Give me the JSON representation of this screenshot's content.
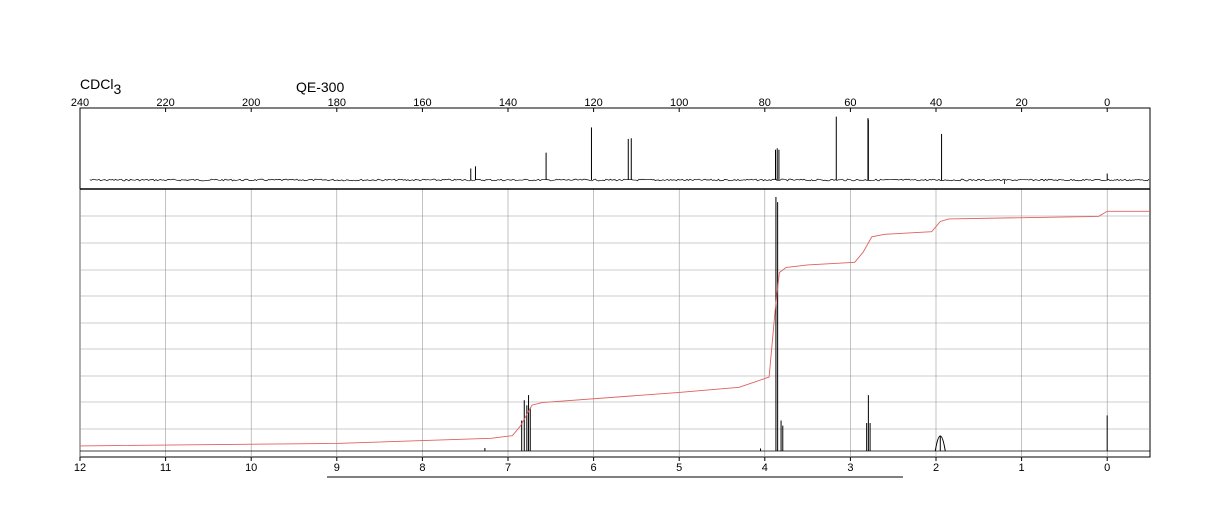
{
  "header": {
    "solvent_main": "CDCl",
    "solvent_sub": "3",
    "instrument": "QE-300"
  },
  "chart_data": [
    {
      "type": "line",
      "name": "13C NMR spectrum",
      "x_axis": {
        "range": [
          240,
          -10
        ],
        "ticks": [
          240,
          220,
          200,
          180,
          160,
          140,
          120,
          100,
          80,
          60,
          40,
          20,
          0
        ],
        "tick_labels": [
          "240",
          "220",
          "200",
          "180",
          "160",
          "140",
          "120",
          "100",
          "80",
          "60",
          "40",
          "20",
          "0"
        ]
      },
      "y_axis": {
        "range": [
          0,
          1
        ]
      },
      "peaks": [
        {
          "x": 148.7,
          "y": 0.16
        },
        {
          "x": 147.6,
          "y": 0.19
        },
        {
          "x": 131.1,
          "y": 0.38
        },
        {
          "x": 120.5,
          "y": 0.73
        },
        {
          "x": 111.9,
          "y": 0.57
        },
        {
          "x": 111.2,
          "y": 0.58
        },
        {
          "x": 77.5,
          "y": 0.42
        },
        {
          "x": 77.1,
          "y": 0.44
        },
        {
          "x": 76.7,
          "y": 0.42
        },
        {
          "x": 63.3,
          "y": 0.88
        },
        {
          "x": 55.9,
          "y": 0.86
        },
        {
          "x": 55.8,
          "y": 0.84
        },
        {
          "x": 38.7,
          "y": 0.64
        },
        {
          "x": 0.0,
          "y": 0.09
        }
      ],
      "grid": false
    },
    {
      "type": "line",
      "name": "1H NMR spectrum",
      "x_axis": {
        "range": [
          12,
          -0.5
        ],
        "ticks": [
          12,
          11,
          10,
          9,
          8,
          7,
          6,
          5,
          4,
          3,
          2,
          1,
          0
        ],
        "tick_labels": [
          "12",
          "11",
          "10",
          "9",
          "8",
          "7",
          "6",
          "5",
          "4",
          "3",
          "2",
          "1",
          "0"
        ]
      },
      "y_axis": {
        "range": [
          0,
          1
        ]
      },
      "peaks": [
        {
          "x": 7.27,
          "y": 0.012
        },
        {
          "x": 6.84,
          "y": 0.12
        },
        {
          "x": 6.81,
          "y": 0.2
        },
        {
          "x": 6.78,
          "y": 0.18
        },
        {
          "x": 6.76,
          "y": 0.22
        },
        {
          "x": 6.74,
          "y": 0.17
        },
        {
          "x": 4.05,
          "y": 0.01
        },
        {
          "x": 3.87,
          "y": 1.0
        },
        {
          "x": 3.85,
          "y": 0.98
        },
        {
          "x": 3.81,
          "y": 0.12
        },
        {
          "x": 3.79,
          "y": 0.1
        },
        {
          "x": 2.81,
          "y": 0.11
        },
        {
          "x": 2.79,
          "y": 0.22
        },
        {
          "x": 2.77,
          "y": 0.11
        },
        {
          "x": 1.95,
          "y": 0.06
        },
        {
          "x": 0.0,
          "y": 0.14
        }
      ],
      "integral_curve": [
        {
          "x": 12.0,
          "y": 0.02
        },
        {
          "x": 9.0,
          "y": 0.03
        },
        {
          "x": 7.2,
          "y": 0.05
        },
        {
          "x": 6.95,
          "y": 0.06
        },
        {
          "x": 6.85,
          "y": 0.1
        },
        {
          "x": 6.72,
          "y": 0.18
        },
        {
          "x": 6.6,
          "y": 0.19
        },
        {
          "x": 5.0,
          "y": 0.23
        },
        {
          "x": 4.3,
          "y": 0.25
        },
        {
          "x": 3.95,
          "y": 0.29
        },
        {
          "x": 3.88,
          "y": 0.55
        },
        {
          "x": 3.83,
          "y": 0.7
        },
        {
          "x": 3.75,
          "y": 0.72
        },
        {
          "x": 3.5,
          "y": 0.73
        },
        {
          "x": 2.95,
          "y": 0.74
        },
        {
          "x": 2.85,
          "y": 0.78
        },
        {
          "x": 2.75,
          "y": 0.84
        },
        {
          "x": 2.6,
          "y": 0.85
        },
        {
          "x": 2.05,
          "y": 0.86
        },
        {
          "x": 1.95,
          "y": 0.9
        },
        {
          "x": 1.85,
          "y": 0.91
        },
        {
          "x": 0.1,
          "y": 0.92
        },
        {
          "x": 0.0,
          "y": 0.94
        },
        {
          "x": -0.5,
          "y": 0.94
        }
      ],
      "grid": true
    }
  ],
  "colors": {
    "trace": "#000000",
    "integral": "#e06060",
    "grid": "#9a9a9a",
    "frame": "#000000"
  }
}
